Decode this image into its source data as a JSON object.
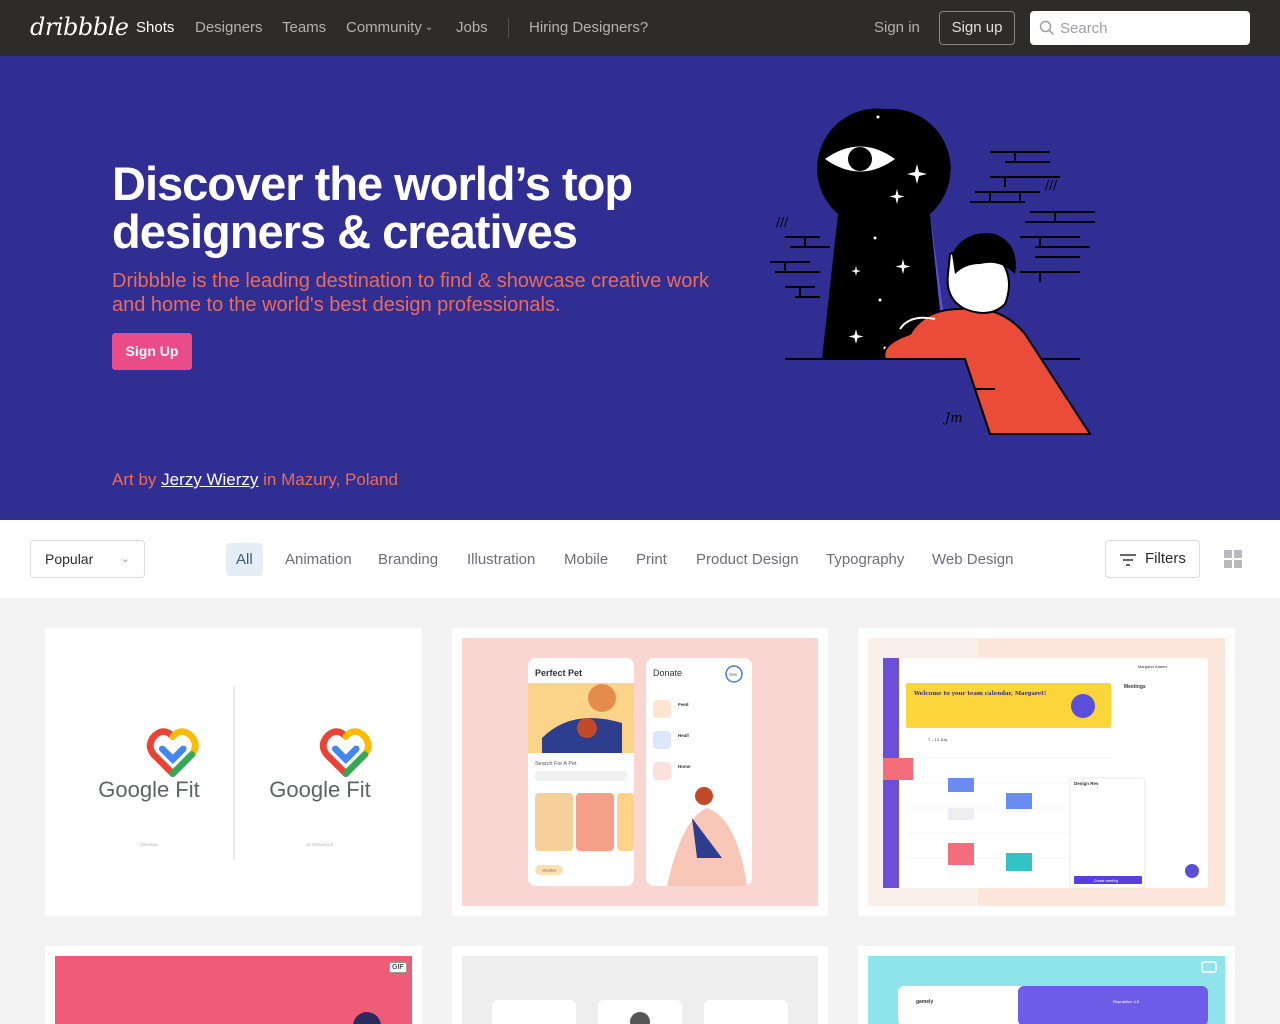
{
  "nav": {
    "logo": "dribbble",
    "links": [
      "Shots",
      "Designers",
      "Teams",
      "Community",
      "Jobs",
      "Hiring Designers?"
    ],
    "sign_in": "Sign in",
    "sign_up": "Sign up",
    "search_placeholder": "Search"
  },
  "hero": {
    "title": "Discover the world’s top designers & creatives",
    "subtitle": "Dribbble is the leading destination to find & showcase creative work and home to the world's best design professionals.",
    "cta": "Sign Up",
    "credit_prefix": "Art by",
    "credit_artist": "Jerzy Wierzy",
    "credit_suffix": "in Mazury, Poland",
    "signature": "Jm"
  },
  "filters": {
    "sort": "Popular",
    "categories": [
      "All",
      "Animation",
      "Branding",
      "Illustration",
      "Mobile",
      "Print",
      "Product Design",
      "Typography",
      "Web Design"
    ],
    "filters_label": "Filters"
  },
  "shots": {
    "s1": {
      "logo_text": "Google Fit",
      "caption_left": "ORIGINAL",
      "caption_right": "ALTERNATIVE"
    },
    "s2": {
      "title1": "Perfect Pet",
      "title2": "Donate",
      "search": "Search For A Pet",
      "badge": "70%",
      "items": [
        "Feed",
        "Heall",
        "Home"
      ],
      "tab": "Shelter"
    },
    "s3": {
      "banner": "Welcome to your team calendar, Margaret!",
      "range": "7 – 13 July",
      "panel": "Meetings",
      "user": "Margaret Adams",
      "popup": "Design Rev",
      "cta": "Create meeting"
    },
    "s4": {
      "badge": "GIF"
    },
    "s6": {
      "brand": "gamely",
      "meta": "Reputation 4.8"
    }
  },
  "colors": {
    "hero_bg": "#302d93",
    "accent_pink": "#ea4c89",
    "accent_coral": "#ea6c59",
    "nav_bg": "#2d2c2b"
  }
}
